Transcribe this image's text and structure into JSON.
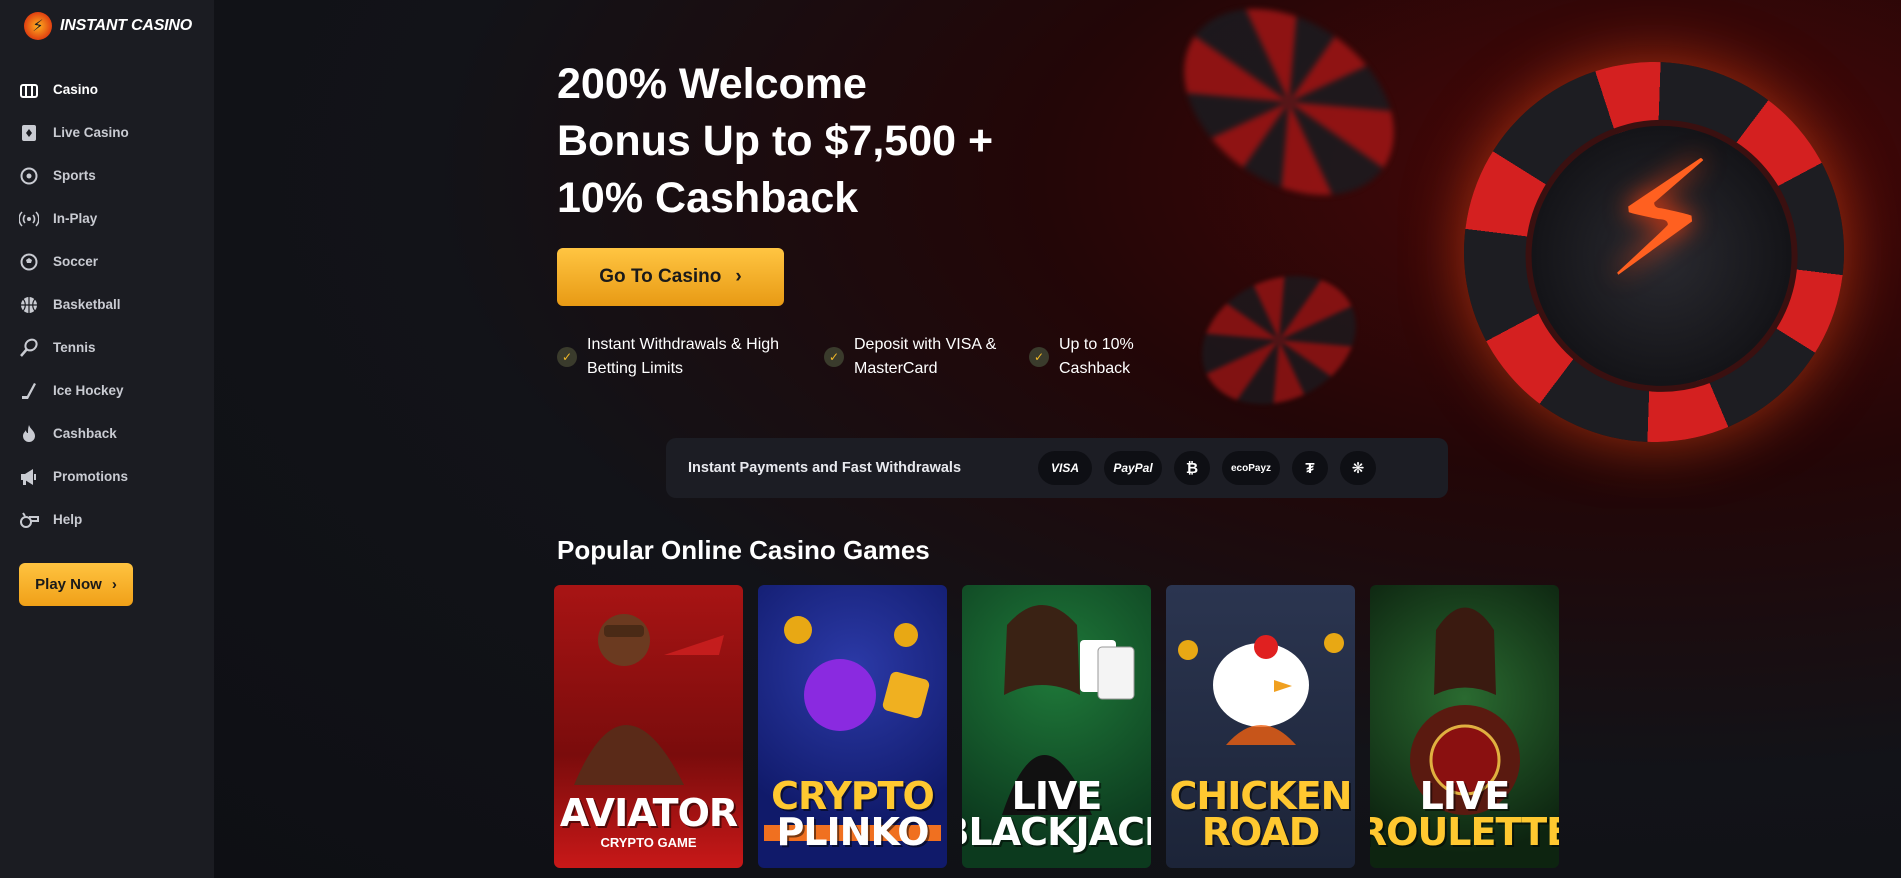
{
  "brand": {
    "name": "INSTANT CASINO"
  },
  "sidebar": {
    "items": [
      {
        "label": "Casino",
        "icon": "casino-icon",
        "active": true
      },
      {
        "label": "Live Casino",
        "icon": "cards-icon"
      },
      {
        "label": "Sports",
        "icon": "ball-icon"
      },
      {
        "label": "In-Play",
        "icon": "broadcast-icon"
      },
      {
        "label": "Soccer",
        "icon": "soccer-icon"
      },
      {
        "label": "Basketball",
        "icon": "basketball-icon"
      },
      {
        "label": "Tennis",
        "icon": "tennis-icon"
      },
      {
        "label": "Ice Hockey",
        "icon": "hockey-icon"
      },
      {
        "label": "Cashback",
        "icon": "flame-icon"
      },
      {
        "label": "Promotions",
        "icon": "megaphone-icon"
      },
      {
        "label": "Help",
        "icon": "whistle-icon"
      }
    ],
    "play_now": "Play Now"
  },
  "hero": {
    "title_line1": "200% Welcome",
    "title_line2": "Bonus Up to $7,500 +",
    "title_line3": "10% Cashback",
    "cta": "Go To Casino",
    "features": [
      {
        "line1": "Instant Withdrawals & High",
        "line2": "Betting Limits"
      },
      {
        "line1": "Deposit with VISA &",
        "line2": "MasterCard"
      },
      {
        "line1": "Up to 10%",
        "line2": "Cashback"
      }
    ]
  },
  "payments": {
    "label": "Instant Payments and Fast Withdrawals",
    "methods": [
      "VISA",
      "PayPal",
      "₿",
      "ecoPayz",
      "₮",
      "❋"
    ]
  },
  "games_section": {
    "title": "Popular Online Casino Games",
    "games": [
      {
        "title_line1": "AVIATOR",
        "title_line2": "",
        "subtitle": "CRYPTO GAME"
      },
      {
        "title_line1": "CRYPTO",
        "title_line2": "PLINKO",
        "subtitle": ""
      },
      {
        "title_line1": "LIVE",
        "title_line2": "BLACKJACK",
        "subtitle": ""
      },
      {
        "title_line1": "CHICKEN",
        "title_line2": "ROAD",
        "subtitle": ""
      },
      {
        "title_line1": "LIVE",
        "title_line2": "ROULETTE",
        "subtitle": ""
      }
    ]
  },
  "colors": {
    "accent": "#f5b02a",
    "sidebar_bg": "#1b1c22",
    "page_bg": "#0e0f14"
  }
}
